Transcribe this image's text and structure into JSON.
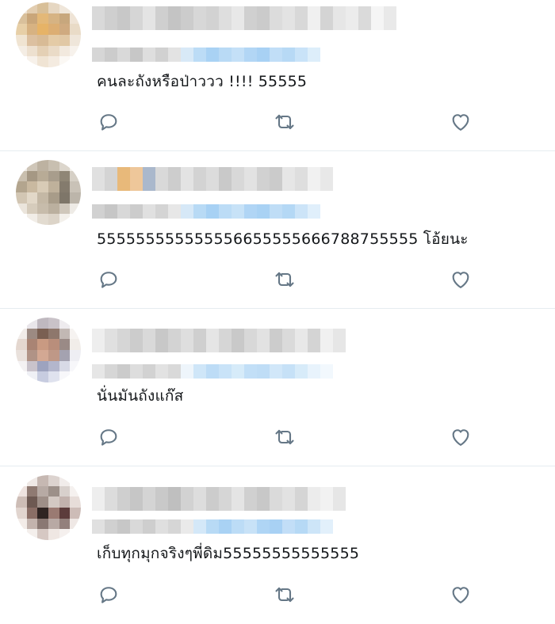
{
  "replies": [
    {
      "text": "คนละถังหรือป่าววว !!!! 55555",
      "actions": {
        "reply": "reply-icon",
        "retweet": "retweet-icon",
        "like": "heart-icon"
      },
      "avatar_palette": [
        "#efe3d3",
        "#e2cdb0",
        "#d8bf98",
        "#e6d7c2",
        "#efe6da",
        "#f2ece4",
        "#d9c09b",
        "#c9a67a",
        "#e3b878",
        "#d6b383",
        "#c7a77d",
        "#efe4d6",
        "#e7cfa7",
        "#d7b282",
        "#e6b367",
        "#dcae73",
        "#cfaa80",
        "#e9dbc7",
        "#f0e4d2",
        "#dcc0a0",
        "#d8bb96",
        "#e4cba6",
        "#e1c8a5",
        "#efe6da",
        "#f4ede4",
        "#ede0cf",
        "#e4d0b5",
        "#eadbc7",
        "#f2e9de",
        "#f7f2ec",
        "#ffffff",
        "#f7f1ea",
        "#f0e4d4",
        "#f4ebe0",
        "#fbf8f4",
        "#ffffff"
      ]
    },
    {
      "text": "555555555555556655555666788755555 โอ้ยนะ",
      "actions": {
        "reply": "reply-icon",
        "retweet": "retweet-icon",
        "like": "heart-icon"
      },
      "avatar_palette": [
        "#eeeae4",
        "#cfc6b8",
        "#bdb2a1",
        "#c8bfb0",
        "#dcd6cc",
        "#f2efea",
        "#c9bfae",
        "#a59884",
        "#b8ab96",
        "#a89d8c",
        "#8f8676",
        "#d6d0c6",
        "#b3a58e",
        "#c9b9a0",
        "#d8cbb6",
        "#bfb19b",
        "#847b6d",
        "#c9c2b7",
        "#d2c6b3",
        "#e2d8c8",
        "#c4b8a5",
        "#a89c89",
        "#7e7669",
        "#bcb5aa",
        "#ebe5dc",
        "#d6ccbc",
        "#c7bcab",
        "#bbb09f",
        "#cfc7bb",
        "#eeebe6",
        "#ffffff",
        "#f1ede7",
        "#e2dbd0",
        "#dcd4c8",
        "#f3f0eb",
        "#ffffff"
      ]
    },
    {
      "text": "นั่นมันถังแก๊ส",
      "actions": {
        "reply": "reply-icon",
        "retweet": "retweet-icon",
        "like": "heart-icon"
      },
      "avatar_palette": [
        "#ffffff",
        "#e9e6ea",
        "#bfb8bf",
        "#c9c2c8",
        "#eeebee",
        "#ffffff",
        "#f1ece9",
        "#9c8a82",
        "#7a5f52",
        "#8e776c",
        "#c2b8b4",
        "#f6f3f1",
        "#e4d7cf",
        "#a98474",
        "#c99a82",
        "#b98e7b",
        "#9a8a86",
        "#f1ede9",
        "#e9e1dc",
        "#b09386",
        "#d3a893",
        "#bf9887",
        "#a4a2b0",
        "#eeeef3",
        "#f4f2f3",
        "#c9c3cb",
        "#9da3bf",
        "#b3b6cc",
        "#d8dae6",
        "#f7f7fa",
        "#ffffff",
        "#eff0f5",
        "#c7cce0",
        "#dfe2ee",
        "#f7f7fa",
        "#ffffff"
      ]
    },
    {
      "text": "เก็บทุกมุกจริงๆพี่ดิม55555555555555",
      "actions": {
        "reply": "reply-icon",
        "retweet": "retweet-icon",
        "like": "heart-icon"
      },
      "avatar_palette": [
        "#ffffff",
        "#efe9e6",
        "#c6b8b2",
        "#dcd3cf",
        "#f1ecea",
        "#ffffff",
        "#eee3df",
        "#8f7a72",
        "#b7aaa4",
        "#9c9089",
        "#d8d0cc",
        "#f5f1ef",
        "#cdbdb6",
        "#6d5952",
        "#9e8f88",
        "#d3c9c3",
        "#c2b2ad",
        "#e7ddd9",
        "#e1d5cf",
        "#8a6e66",
        "#2f2422",
        "#9a7a72",
        "#5c3c3b",
        "#cdbcb7",
        "#f3ece8",
        "#c3b3ad",
        "#8a7873",
        "#b8a9a4",
        "#93807c",
        "#efe8e5",
        "#ffffff",
        "#f4efec",
        "#d6c8c3",
        "#efe7e3",
        "#f5f0ee",
        "#ffffff"
      ]
    }
  ],
  "name_pixels": [
    [
      "#d9d9d9",
      "#cfcfcf",
      "#c8c8c8",
      "#d6d6d6",
      "#e4e4e4",
      "#cfcfcf",
      "#c4c4c4",
      "#cccccc",
      "#d7d7d7",
      "#d2d2d2",
      "#dedede",
      "#e8e8e8",
      "#d0d0d0",
      "#cbcbcb",
      "#dcdcdc",
      "#e3e3e3",
      "#d8d8d8",
      "#f0f0f0",
      "#d4d4d4",
      "#e6e6e6",
      "#ececec",
      "#dadada",
      "#f5f5f5",
      "#e9e9e9",
      "#ffffff"
    ],
    [
      "#e0e0e0",
      "#d4d4d4",
      "#e8b97a",
      "#eec79a",
      "#aab8cc",
      "#d9d9d9",
      "#cdcdcd",
      "#e3e3e3",
      "#d3d3d3",
      "#dcdcdc",
      "#c9c9c9",
      "#d8d8d8",
      "#e2e2e2",
      "#d1d1d1",
      "#cbcbcb",
      "#e6e6e6",
      "#dedede",
      "#f1f1f1",
      "#e8e8e8",
      "#ffffff"
    ],
    [
      "#eeeeee",
      "#e0e0e0",
      "#d6d6d6",
      "#cccccc",
      "#d9d9d9",
      "#c8c8c8",
      "#d3d3d3",
      "#dedede",
      "#cfcfcf",
      "#e5e5e5",
      "#d6d6d6",
      "#c9c9c9",
      "#d8d8d8",
      "#e2e2e2",
      "#cccccc",
      "#dadada",
      "#e8e8e8",
      "#d4d4d4",
      "#f0f0f0",
      "#e6e6e6"
    ],
    [
      "#eeeeee",
      "#dcdcdc",
      "#cfcfcf",
      "#c6c6c6",
      "#d4d4d4",
      "#c9c9c9",
      "#bfbfbf",
      "#d2d2d2",
      "#dddddd",
      "#cccccc",
      "#d6d6d6",
      "#e4e4e4",
      "#d0d0d0",
      "#c8c8c8",
      "#dadada",
      "#e2e2e2",
      "#d5d5d5",
      "#ececec",
      "#f2f2f2",
      "#e6e6e6"
    ]
  ],
  "handle_pixels": [
    [
      "#d6d6d6",
      "#cccccc",
      "#d9d9d9",
      "#c7c7c7",
      "#dedede",
      "#d1d1d1",
      "#e3e3e3",
      "#d8e9f7",
      "#bcdcf6",
      "#a9d2f4",
      "#b9daf5",
      "#c4e0f7",
      "#b2d6f5",
      "#a8d1f4",
      "#c1def7",
      "#b7d9f5",
      "#c9e3f8",
      "#ddeefa"
    ],
    [
      "#d1d1d1",
      "#c6c6c6",
      "#d8d8d8",
      "#cccccc",
      "#e0e0e0",
      "#d4d4d4",
      "#e7e7e7",
      "#d6e8f7",
      "#b8daf5",
      "#a7d1f4",
      "#bcdcf6",
      "#c7e2f7",
      "#b0d5f5",
      "#a9d2f4",
      "#bfddf6",
      "#b4d8f5",
      "#cce4f8",
      "#e0effb"
    ],
    [
      "#e6e6e6",
      "#d6d6d6",
      "#cbcbcb",
      "#dddddd",
      "#d2d2d2",
      "#e2e2e2",
      "#d9d9d9",
      "#eef5fb",
      "#cfe6f8",
      "#bddcf6",
      "#c9e3f8",
      "#d6ebf9",
      "#c2dff7",
      "#bfddf6",
      "#d1e7f9",
      "#c6e1f7",
      "#d7ebf9",
      "#e8f3fc",
      "#f2f8fd"
    ],
    [
      "#e0e0e0",
      "#d0d0d0",
      "#c7c7c7",
      "#d9d9d9",
      "#cecece",
      "#dfdfdf",
      "#d6d6d6",
      "#eaeaea",
      "#d4e8f8",
      "#b8daf5",
      "#a9d2f4",
      "#bcdcf6",
      "#c8e2f7",
      "#afd5f5",
      "#a8d1f4",
      "#c2def7",
      "#b6d9f5",
      "#cde5f8",
      "#e2f0fb"
    ]
  ]
}
